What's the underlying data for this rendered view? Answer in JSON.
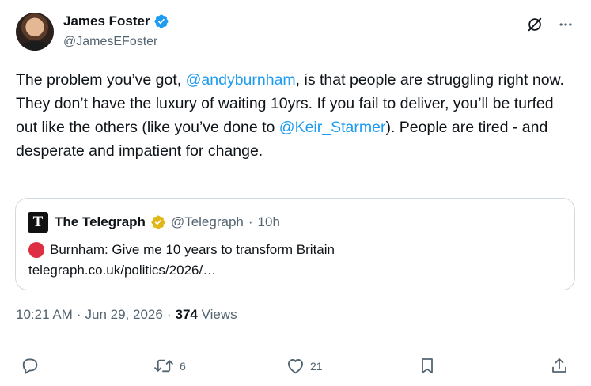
{
  "author": {
    "display_name": "James Foster",
    "handle": "@JamesEFoster"
  },
  "tweet": {
    "segments": [
      {
        "text": "The problem you’ve got, ",
        "type": "text"
      },
      {
        "text": "@andyburnham",
        "type": "mention"
      },
      {
        "text": ", is that people are struggling right now. They don’t have the luxury of waiting 10yrs. If you fail to deliver, you’ll be turfed out like the others (like you’ve done to ",
        "type": "text"
      },
      {
        "text": "@Keir_Starmer",
        "type": "mention"
      },
      {
        "text": "). People are tired - and desperate and impatient for change.",
        "type": "text"
      }
    ]
  },
  "quote": {
    "display_name": "The Telegraph",
    "handle": "@Telegraph",
    "separator": "·",
    "age": "10h",
    "logo_letter": "T",
    "headline": "Burnham: Give me 10 years to transform Britain",
    "link": "telegraph.co.uk/politics/2026/…"
  },
  "meta": {
    "time": "10:21 AM",
    "separator": "·",
    "date": "Jun 29, 2026",
    "separator2": "·",
    "views_count": "374",
    "views_label": "Views"
  },
  "actions": {
    "reply_count": "",
    "retweet_count": "6",
    "like_count": "21"
  },
  "icons": {
    "verified": "verified-badge-icon",
    "grok": "grok-icon",
    "more": "more-icon",
    "reply": "reply-icon",
    "retweet": "retweet-icon",
    "like": "like-icon",
    "bookmark": "bookmark-icon",
    "share": "share-icon"
  },
  "colors": {
    "accent": "#1d9bf0",
    "secondary_text": "#536471",
    "gold_badge": "#e2b719",
    "red_circle": "#dd2e44"
  }
}
